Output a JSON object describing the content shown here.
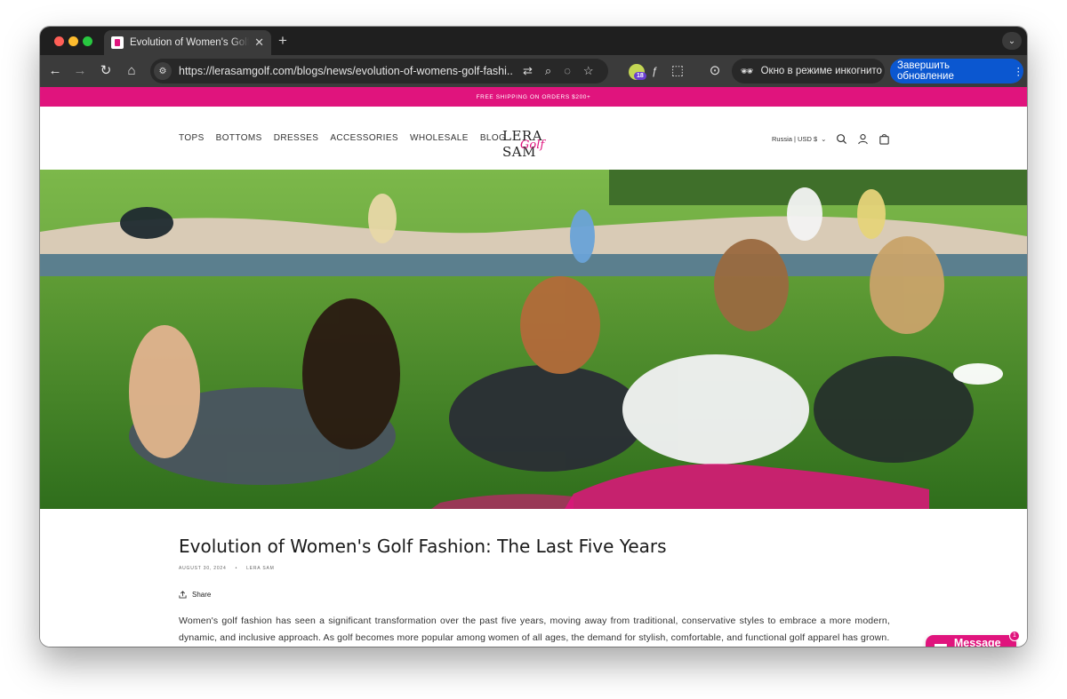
{
  "browser": {
    "tab_title": "Evolution of Women's Golf Fashion: The Last Five Years",
    "url": "https://lerasamgolf.com/blogs/news/evolution-of-womens-golf-fashi...",
    "ext_badge_count": "18",
    "incognito_label": "Окно в режиме инкогнито",
    "update_label": "Завершить обновление"
  },
  "site": {
    "announcement": "FREE SHIPPING ON ORDERS $200+",
    "nav": [
      "TOPS",
      "BOTTOMS",
      "DRESSES",
      "ACCESSORIES",
      "WHOLESALE",
      "BLOG"
    ],
    "logo_word": "LERA SAM",
    "logo_script": "Golf",
    "locale": "Russia | USD $",
    "brand_color": "#e0147d"
  },
  "article": {
    "title": "Evolution of Women's Golf Fashion: The Last Five Years",
    "date": "AUGUST 30, 2024",
    "author": "LERA SAM",
    "share": "Share",
    "body": "Women's golf fashion has seen a significant transformation over the past five years, moving away from traditional, conservative styles to embrace a more modern, dynamic, and inclusive approach. As golf becomes more popular among women of all ages, the demand for stylish, comfortable, and functional golf apparel has grown."
  },
  "chat": {
    "label": "Message us",
    "badge": "1"
  }
}
